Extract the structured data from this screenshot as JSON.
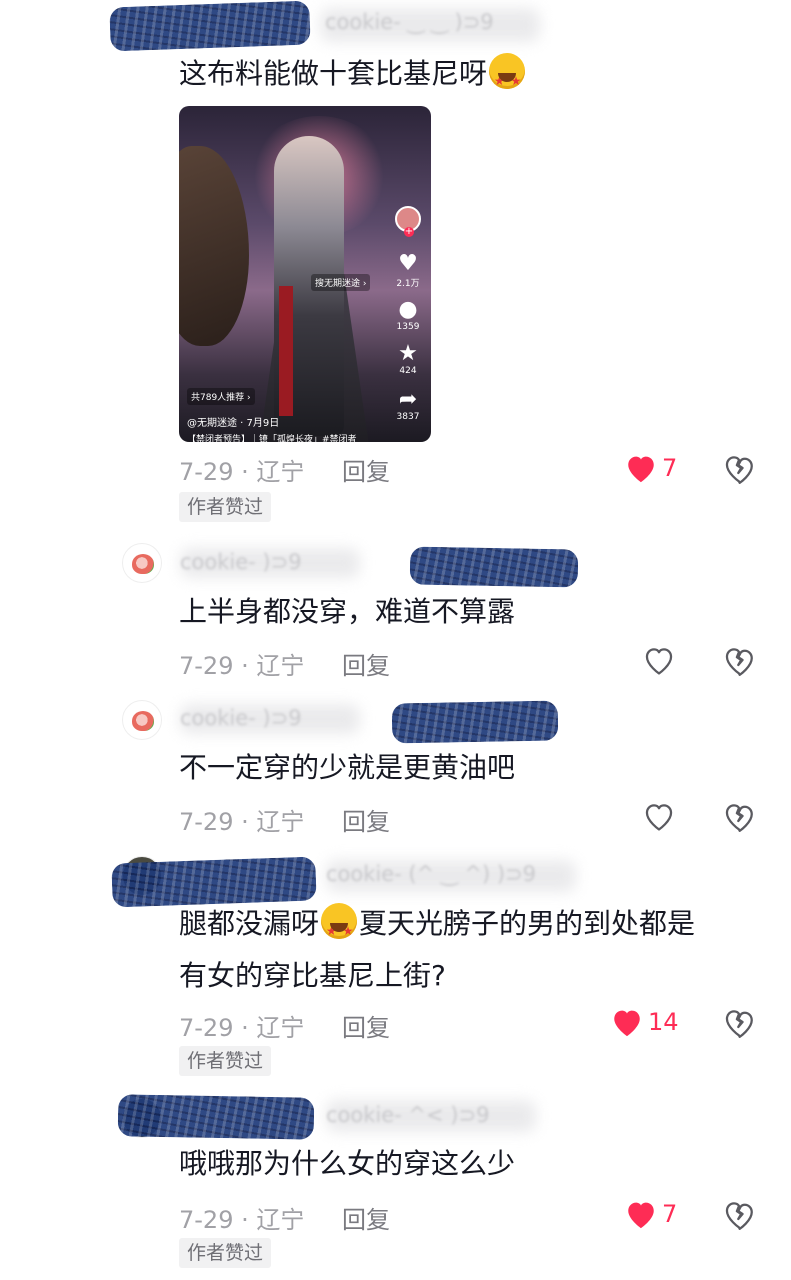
{
  "accent_color": "#fe2c55",
  "comments": [
    {
      "username_visible": "cookie-  ‿  ‿  )⊃9",
      "text": "这布料能做十套比基尼呀",
      "has_emoji": true,
      "date_location": "7-29 · 辽宁",
      "reply_label": "回复",
      "like_count": "7",
      "liked": true,
      "badge": "作者赞过"
    },
    {
      "username_visible": "cookie-        )⊃9",
      "text": "上半身都没穿，难道不算露",
      "date_location": "7-29 · 辽宁",
      "reply_label": "回复",
      "like_count": "",
      "liked": false
    },
    {
      "username_visible": "cookie-        )⊃9",
      "text": "不一定穿的少就是更黄油吧",
      "date_location": "7-29 · 辽宁",
      "reply_label": "回复",
      "like_count": "",
      "liked": false
    },
    {
      "username_visible": "cookie-  (^ ‿ ^)  )⊃9",
      "text_line1_a": "腿都没漏呀",
      "text_line1_b": "夏天光膀子的男的到处都是",
      "text_line2": "有女的穿比基尼上街?",
      "date_location": "7-29 · 辽宁",
      "reply_label": "回复",
      "like_count": "14",
      "liked": true,
      "badge": "作者赞过"
    },
    {
      "username_visible": "cookie-   ^<   )⊃9",
      "text": "哦哦那为什么女的穿这么少",
      "date_location": "7-29 · 辽宁",
      "reply_label": "回复",
      "like_count": "7",
      "liked": true,
      "badge": "作者赞过"
    }
  ],
  "video_card": {
    "search_label": "搜无期迷途 ›",
    "like_count": "2.1万",
    "comment_count": "1359",
    "favorite_count": "424",
    "share_count": "3837",
    "recommend_label": "共789人推荐 ›",
    "author": "@无期迷途 · 7月9日",
    "description": "【禁闭者预告】｜镣「孤煌长夜」#禁闭者",
    "icons": [
      "heart-icon",
      "comment-icon",
      "star-icon",
      "share-icon"
    ]
  }
}
